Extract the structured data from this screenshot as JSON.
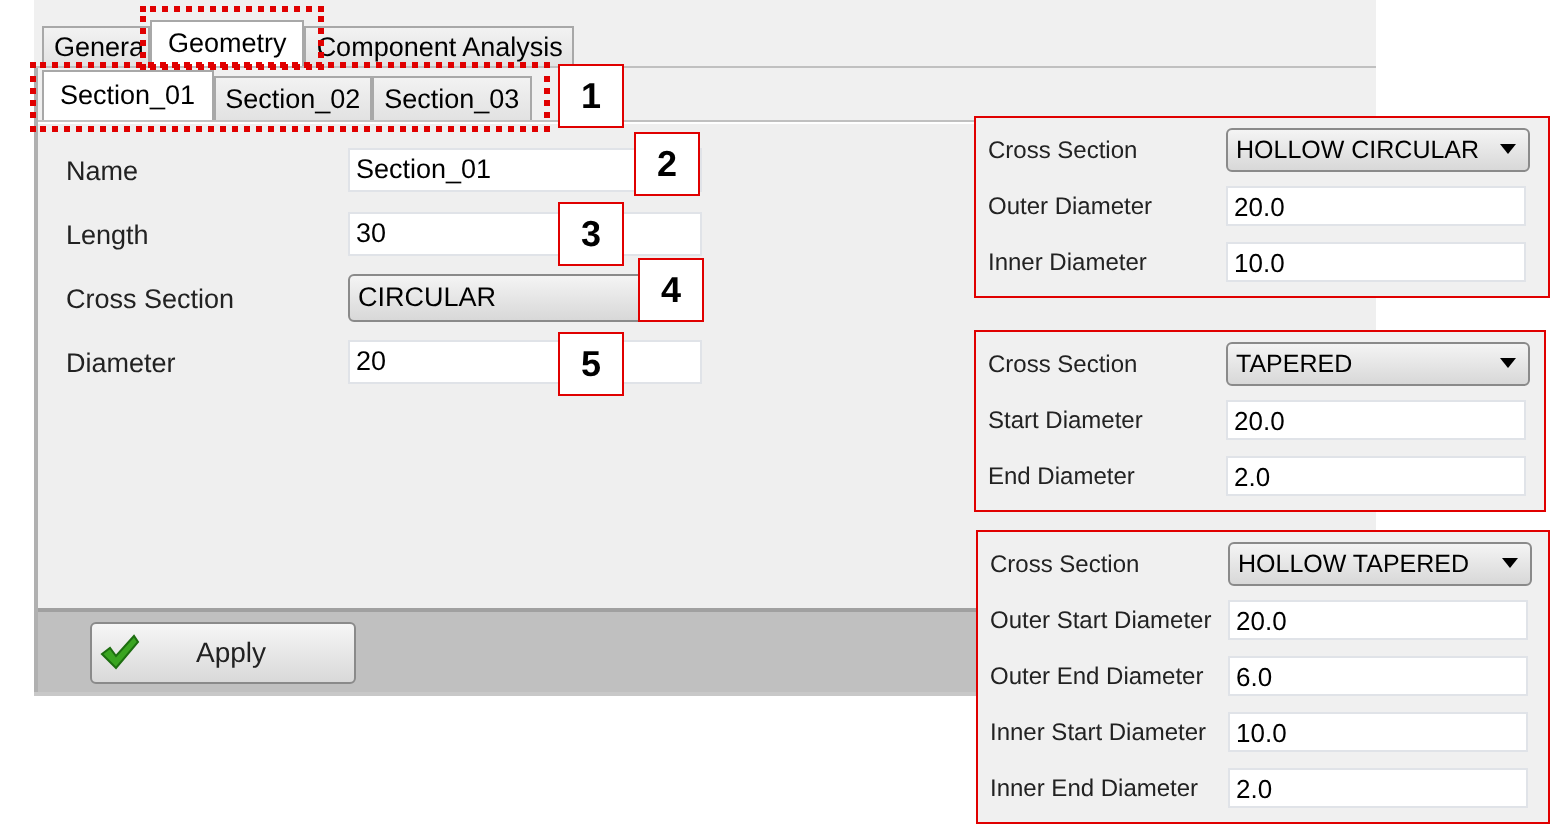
{
  "tabs": [
    {
      "label": "Genera",
      "selected": false
    },
    {
      "label": "Geometry",
      "selected": true
    },
    {
      "label": "Component Analysis",
      "selected": false
    }
  ],
  "section_tabs": [
    {
      "label": "Section_01",
      "selected": true
    },
    {
      "label": "Section_02",
      "selected": false
    },
    {
      "label": "Section_03",
      "selected": false
    }
  ],
  "fields": [
    {
      "label": "Name",
      "kind": "text",
      "value": "Section_01"
    },
    {
      "label": "Length",
      "kind": "text",
      "value": "30"
    },
    {
      "label": "Cross Section",
      "kind": "dropdown",
      "value": "CIRCULAR"
    },
    {
      "label": "Diameter",
      "kind": "text",
      "value": "20"
    }
  ],
  "apply_button": {
    "label": "Apply"
  },
  "callouts": [
    "1",
    "2",
    "3",
    "4",
    "5"
  ],
  "panels": [
    {
      "rows": [
        {
          "label": "Cross Section",
          "kind": "dropdown",
          "value": "HOLLOW CIRCULAR"
        },
        {
          "label": "Outer Diameter",
          "kind": "text",
          "value": "20.0"
        },
        {
          "label": "Inner Diameter",
          "kind": "text",
          "value": "10.0"
        }
      ]
    },
    {
      "rows": [
        {
          "label": "Cross Section",
          "kind": "dropdown",
          "value": "TAPERED"
        },
        {
          "label": "Start Diameter",
          "kind": "text",
          "value": "20.0"
        },
        {
          "label": "End Diameter",
          "kind": "text",
          "value": "2.0"
        }
      ]
    },
    {
      "rows": [
        {
          "label": "Cross Section",
          "kind": "dropdown",
          "value": "HOLLOW TAPERED"
        },
        {
          "label": "Outer Start Diameter",
          "kind": "text",
          "value": "20.0"
        },
        {
          "label": "Outer End Diameter",
          "kind": "text",
          "value": "6.0"
        },
        {
          "label": "Inner Start Diameter",
          "kind": "text",
          "value": "10.0"
        },
        {
          "label": "Inner End Diameter",
          "kind": "text",
          "value": "2.0"
        }
      ]
    }
  ]
}
